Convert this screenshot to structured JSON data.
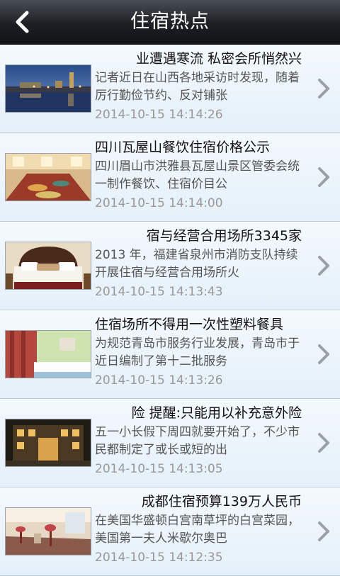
{
  "header": {
    "title": "住宿热点",
    "back_icon": "chevron-left-icon"
  },
  "items": [
    {
      "headline": "业遭遇寒流 私密会所悄然兴",
      "summary": "记者近日在山西各地采访时发现，随着厉行勤俭节约、反对铺张",
      "date": "2014-10-15 14:14:26"
    },
    {
      "headline": "四川瓦屋山餐饮住宿价格公示",
      "summary": "四川眉山市洪雅县瓦屋山景区管委会统一制作餐饮、住宿价目公",
      "date": "2014-10-15 14:14:00"
    },
    {
      "headline": "宿与经营合用场所3345家",
      "summary": "2013 年，福建省泉州市消防支队持续开展住宿与经营合用场所火",
      "date": "2014-10-15 14:13:43"
    },
    {
      "headline": "住宿场所不得用一次性塑料餐具",
      "summary": "为规范青岛市服务行业发展，青岛市于近日编制了第十二批服务",
      "date": "2014-10-15 14:13:26"
    },
    {
      "headline": "险 提醒:只能用以补充意外险",
      "summary": "五一小长假下周四就要开始了，不少市民都制定了或长或短的出",
      "date": "2014-10-15 14:13:05"
    },
    {
      "headline": "成都住宿预算139万人民币",
      "summary": "在美国华盛顿白宫南草坪的白宫菜园，美国第一夫人米歇尔奥巴",
      "date": "2014-10-15 14:12:35"
    }
  ]
}
